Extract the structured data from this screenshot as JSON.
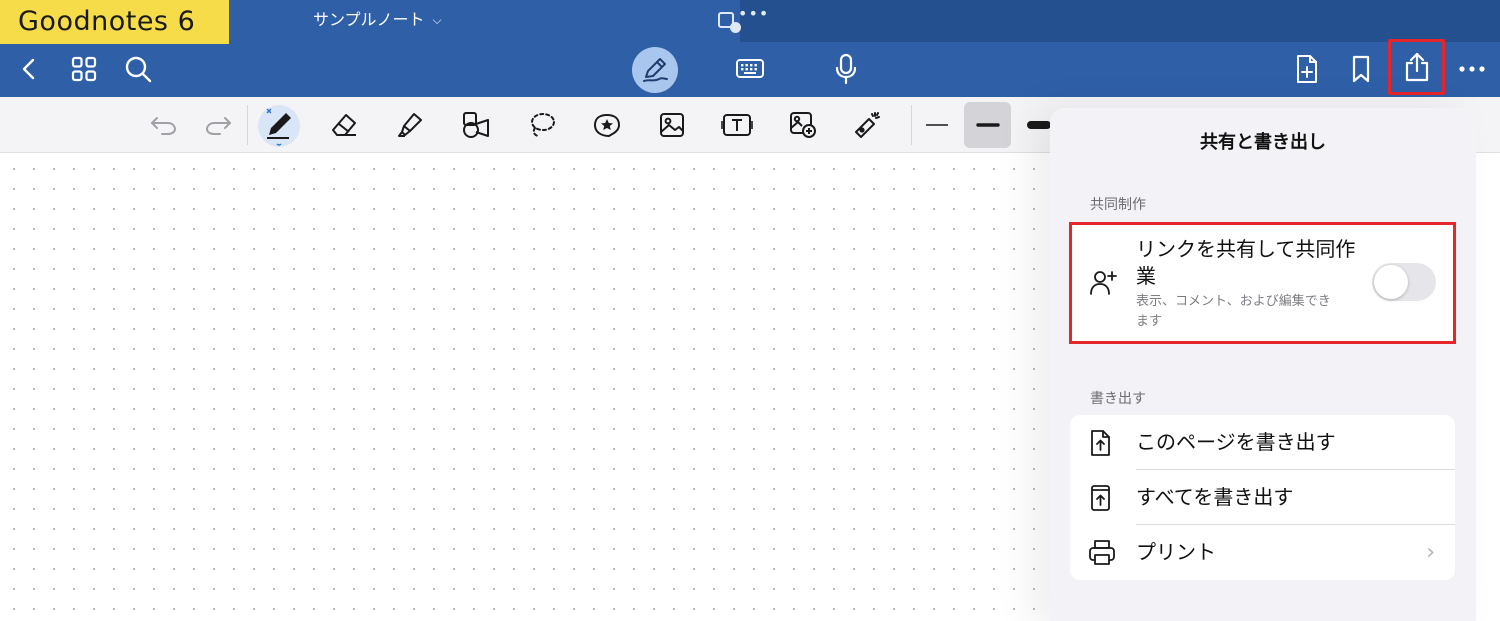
{
  "app": {
    "brand_label": "Goodnotes 6",
    "document_title": "サンプルノート"
  },
  "colors": {
    "topbar": "#2f5fa7",
    "brand_badge": "#f7dc4a",
    "highlight_outline": "#e5262b",
    "panel_bg": "#f2f2f7"
  },
  "toolbar": {
    "left_icons": [
      "back-chevron-icon",
      "grid-view-icon",
      "search-icon"
    ],
    "center_icons": [
      "pen-mode-icon",
      "keyboard-icon",
      "microphone-icon"
    ],
    "right_icons": [
      "add-page-icon",
      "bookmark-icon",
      "share-export-icon",
      "more-icon"
    ]
  },
  "tools": [
    "undo-icon",
    "redo-icon",
    "pen-icon",
    "eraser-icon",
    "highlighter-icon",
    "shapes-icon",
    "lasso-icon",
    "sticker-icon",
    "image-icon",
    "text-box-icon",
    "camera-image-icon",
    "laser-pointer-icon",
    "thin-line-icon",
    "medium-line-icon",
    "thick-line-icon"
  ],
  "share_panel": {
    "title": "共有と書き出し",
    "collab_section_label": "共同制作",
    "collab": {
      "title": "リンクを共有して共同作業",
      "subtitle": "表示、コメント、および編集できます",
      "toggle_on": false
    },
    "export_section_label": "書き出す",
    "export_items": [
      {
        "label": "このページを書き出す",
        "icon": "export-page-icon"
      },
      {
        "label": "すべてを書き出す",
        "icon": "export-all-icon"
      },
      {
        "label": "プリント",
        "icon": "printer-icon"
      }
    ]
  }
}
